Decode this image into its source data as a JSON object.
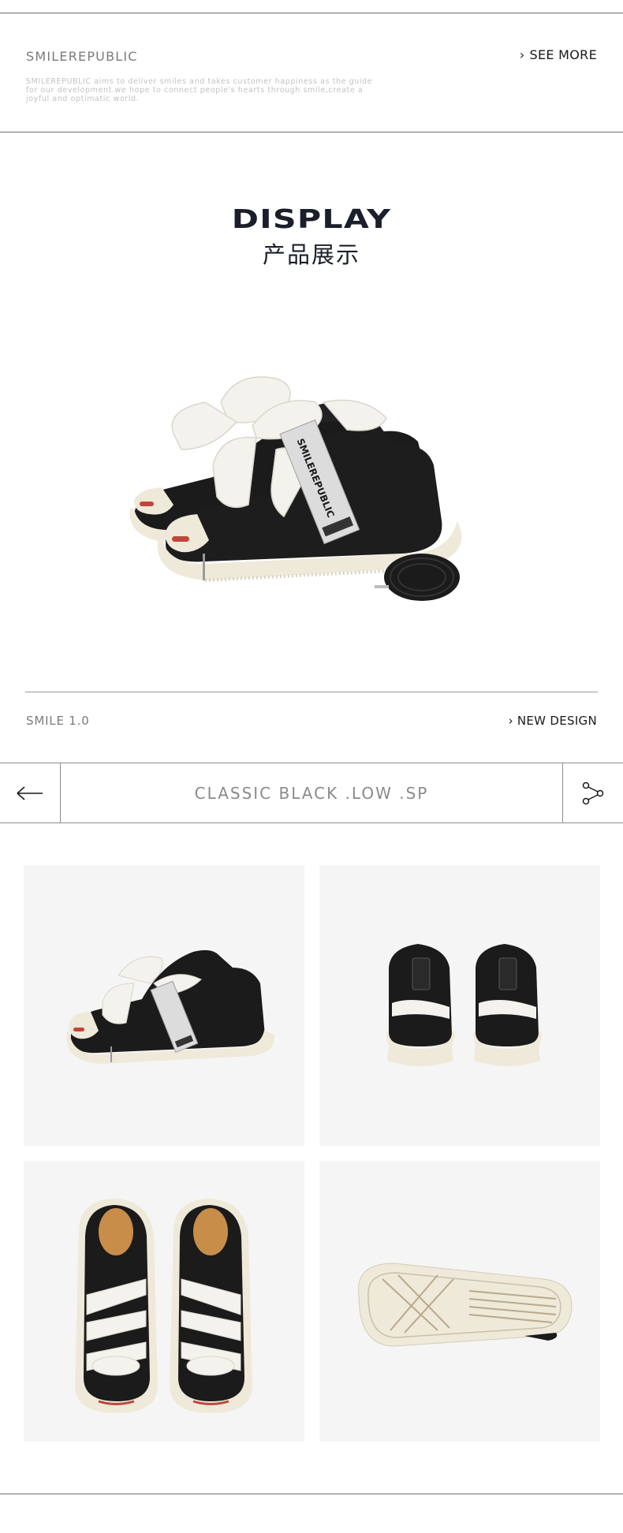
{
  "header": {
    "brand": "SMILEREPUBLIC",
    "description": "SMILEREPUBLIC aims to deliver smiles and takes customer happiness as the guide for our development.we hope to connect people's hearts through smile,create a joyful and optimatic world.",
    "see_more_label": "SEE MORE"
  },
  "display": {
    "title": "DISPLAY",
    "subtitle": "产品展示"
  },
  "hero": {
    "tag_brand": "SMILEREPUBLIC"
  },
  "model_row": {
    "model": "SMILE 1.0",
    "new_design_label": "NEW DESIGN"
  },
  "product_bar": {
    "product_name": "CLASSIC BLACK .LOW .SP"
  },
  "gallery": {
    "views": [
      "side-view",
      "back-view",
      "top-view",
      "sole-view"
    ]
  },
  "icons": {
    "back": "arrow-left-icon",
    "share": "share-icon",
    "chevron": "chevron-right-icon"
  },
  "colors": {
    "shoe_black": "#1b1b1b",
    "sole_cream": "#efe9da",
    "lace_white": "#f4f2ec",
    "tile_bg": "#f5f5f5",
    "accent_red": "#c0463a"
  }
}
